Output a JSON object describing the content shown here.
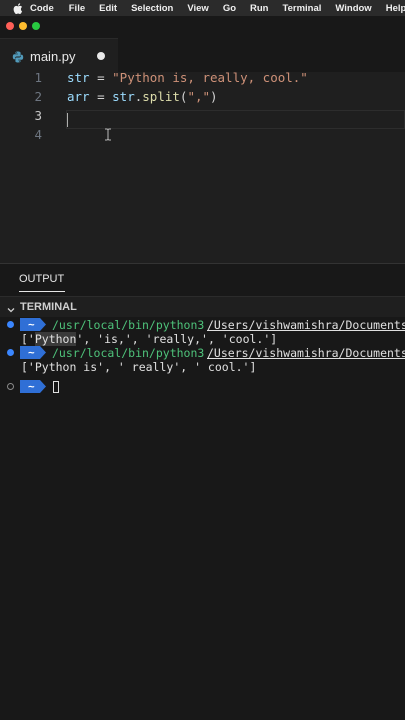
{
  "menubar": {
    "items": [
      "Code",
      "File",
      "Edit",
      "Selection",
      "View",
      "Go",
      "Run",
      "Terminal",
      "Window",
      "Help"
    ]
  },
  "window": {
    "traffic_colors": [
      "#ff5f57",
      "#febc2e",
      "#28c840"
    ]
  },
  "editor": {
    "tab": {
      "filename": "main.py",
      "unsaved": true,
      "icon": "python-icon"
    },
    "line_numbers": [
      "1",
      "2",
      "3",
      "4"
    ],
    "current_line": 3,
    "lines": [
      [
        {
          "t": "str",
          "c": "var"
        },
        {
          "t": " = ",
          "c": "op"
        },
        {
          "t": "\"Python is, really, cool.\"",
          "c": "str"
        }
      ],
      [
        {
          "t": "arr",
          "c": "var"
        },
        {
          "t": " = ",
          "c": "op"
        },
        {
          "t": "str",
          "c": "var"
        },
        {
          "t": ".",
          "c": "op"
        },
        {
          "t": "split",
          "c": "fn"
        },
        {
          "t": "(",
          "c": "op"
        },
        {
          "t": "\",\"",
          "c": "str"
        },
        {
          "t": ")",
          "c": "op"
        }
      ],
      [],
      []
    ]
  },
  "panel": {
    "output_tab": "OUTPUT",
    "terminal_label": "TERMINAL",
    "prompt_symbol": "~",
    "rows": [
      {
        "type": "cmd",
        "status": "ok",
        "command": "/usr/local/bin/python3",
        "path": "/Users/vishwamishra/Documents/"
      },
      {
        "type": "out",
        "highlight": "Python",
        "before": "['",
        "after": "', 'is,', 'really,', 'cool.']"
      },
      {
        "type": "cmd",
        "status": "ok",
        "command": "/usr/local/bin/python3",
        "path": "/Users/vishwamishra/Documents/"
      },
      {
        "type": "out",
        "highlight": "",
        "before": "['Python is', ' really', ' cool.']",
        "after": ""
      },
      {
        "type": "prompt",
        "status": "empty"
      }
    ]
  },
  "colors": {
    "prompt_badge": "#2f6fd6",
    "success_dot": "#3a86ff",
    "command_text": "#4ec27a"
  }
}
